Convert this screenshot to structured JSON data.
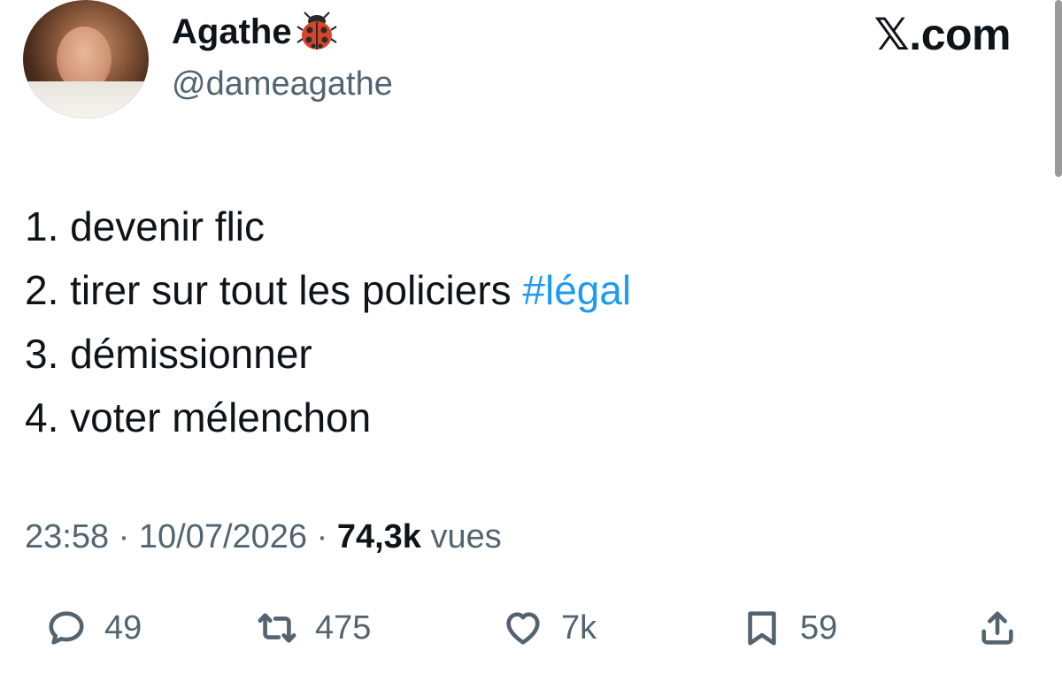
{
  "header": {
    "display_name": "Agathe",
    "name_emoji": "ladybug-icon",
    "handle": "@dameagathe",
    "brand": "𝕏.com"
  },
  "tweet": {
    "lines": [
      {
        "text": "1. devenir flic",
        "hashtag": ""
      },
      {
        "text": "2. tirer sur tout les policiers ",
        "hashtag": "#légal"
      },
      {
        "text": "3. démissionner",
        "hashtag": ""
      },
      {
        "text": "4. voter mélenchon",
        "hashtag": ""
      }
    ],
    "hashtag_color": "#1d9bf0"
  },
  "meta": {
    "time": "23:58",
    "separator": " · ",
    "date": "10/07/2026",
    "views_count": "74,3k",
    "views_label": " vues"
  },
  "actions": {
    "reply_count": "49",
    "retweet_count": "475",
    "like_count": "7k",
    "bookmark_count": "59"
  },
  "colors": {
    "text": "#0f1419",
    "secondary": "#536471",
    "accent": "#1d9bf0"
  }
}
